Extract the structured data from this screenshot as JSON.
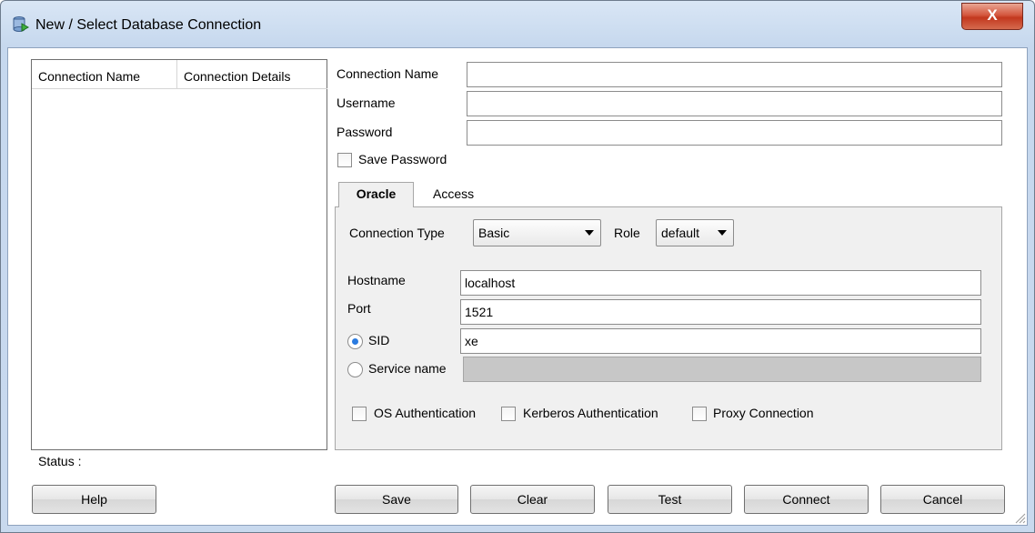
{
  "window": {
    "title": "New / Select Database Connection",
    "close_glyph": "X"
  },
  "connection_list": {
    "columns": [
      "Connection Name",
      "Connection Details"
    ],
    "rows": []
  },
  "status": {
    "label": "Status :"
  },
  "form": {
    "connection_name": {
      "label": "Connection Name",
      "value": ""
    },
    "username": {
      "label": "Username",
      "value": ""
    },
    "password": {
      "label": "Password",
      "value": ""
    },
    "save_password": {
      "label": "Save Password",
      "checked": false
    }
  },
  "tabs": {
    "oracle": "Oracle",
    "access": "Access",
    "selected": "Oracle"
  },
  "oracle": {
    "connection_type": {
      "label": "Connection Type",
      "value": "Basic"
    },
    "role": {
      "label": "Role",
      "value": "default"
    },
    "hostname": {
      "label": "Hostname",
      "value": "localhost"
    },
    "port": {
      "label": "Port",
      "value": "1521"
    },
    "sid": {
      "label": "SID",
      "value": "xe",
      "selected": true
    },
    "service_name": {
      "label": "Service name",
      "value": "",
      "selected": false
    },
    "os_auth": {
      "label": "OS Authentication",
      "checked": false
    },
    "kerberos_auth": {
      "label": "Kerberos Authentication",
      "checked": false
    },
    "proxy_connection": {
      "label": "Proxy Connection",
      "checked": false
    }
  },
  "buttons": {
    "help": "Help",
    "save": "Save",
    "clear": "Clear",
    "test": "Test",
    "connect": "Connect",
    "cancel": "Cancel"
  },
  "icons": {
    "app": "database-connect-icon",
    "close": "close-icon",
    "dropdown": "chevron-down-icon",
    "resize": "resize-grip-icon"
  }
}
